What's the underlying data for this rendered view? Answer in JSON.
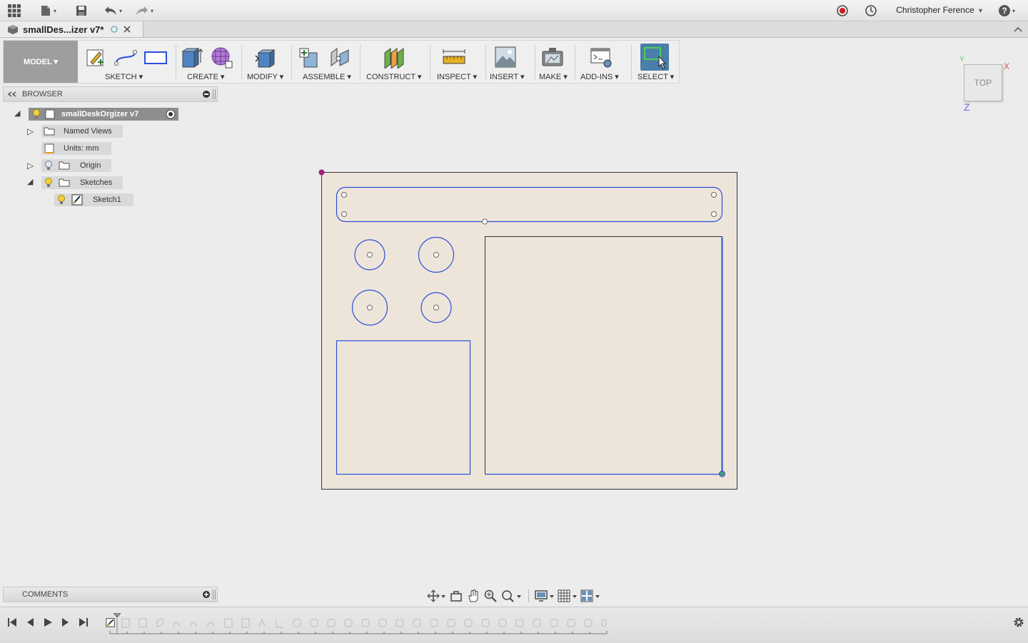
{
  "topbar": {
    "user_name": "Christopher Ference",
    "caret": "▾",
    "help": "?"
  },
  "document": {
    "tab_title": "smallDes...izer v7*"
  },
  "toolbar": {
    "workspace": "MODEL ▾",
    "groups": [
      {
        "label": "SKETCH ▾"
      },
      {
        "label": "CREATE ▾"
      },
      {
        "label": "MODIFY ▾"
      },
      {
        "label": "ASSEMBLE ▾"
      },
      {
        "label": "CONSTRUCT ▾"
      },
      {
        "label": "INSPECT ▾"
      },
      {
        "label": "INSERT ▾"
      },
      {
        "label": "MAKE ▾"
      },
      {
        "label": "ADD-INS ▾"
      },
      {
        "label": "SELECT ▾"
      }
    ]
  },
  "browser": {
    "title": "BROWSER",
    "root": "smallDeskOrgizer v7",
    "items": [
      {
        "label": "Named Views"
      },
      {
        "label": "Units: mm"
      },
      {
        "label": "Origin"
      },
      {
        "label": "Sketches"
      },
      {
        "label": "Sketch1"
      }
    ]
  },
  "comments": {
    "title": "COMMENTS"
  },
  "viewcube": {
    "face": "TOP",
    "axis_x": "X",
    "axis_y": "Y",
    "axis_z": "Z"
  },
  "colors": {
    "sketch_line": "#2a50d8",
    "sketch_fill": "#eee5da",
    "select_active": "#4b7eaa",
    "record": "#d0181f"
  }
}
